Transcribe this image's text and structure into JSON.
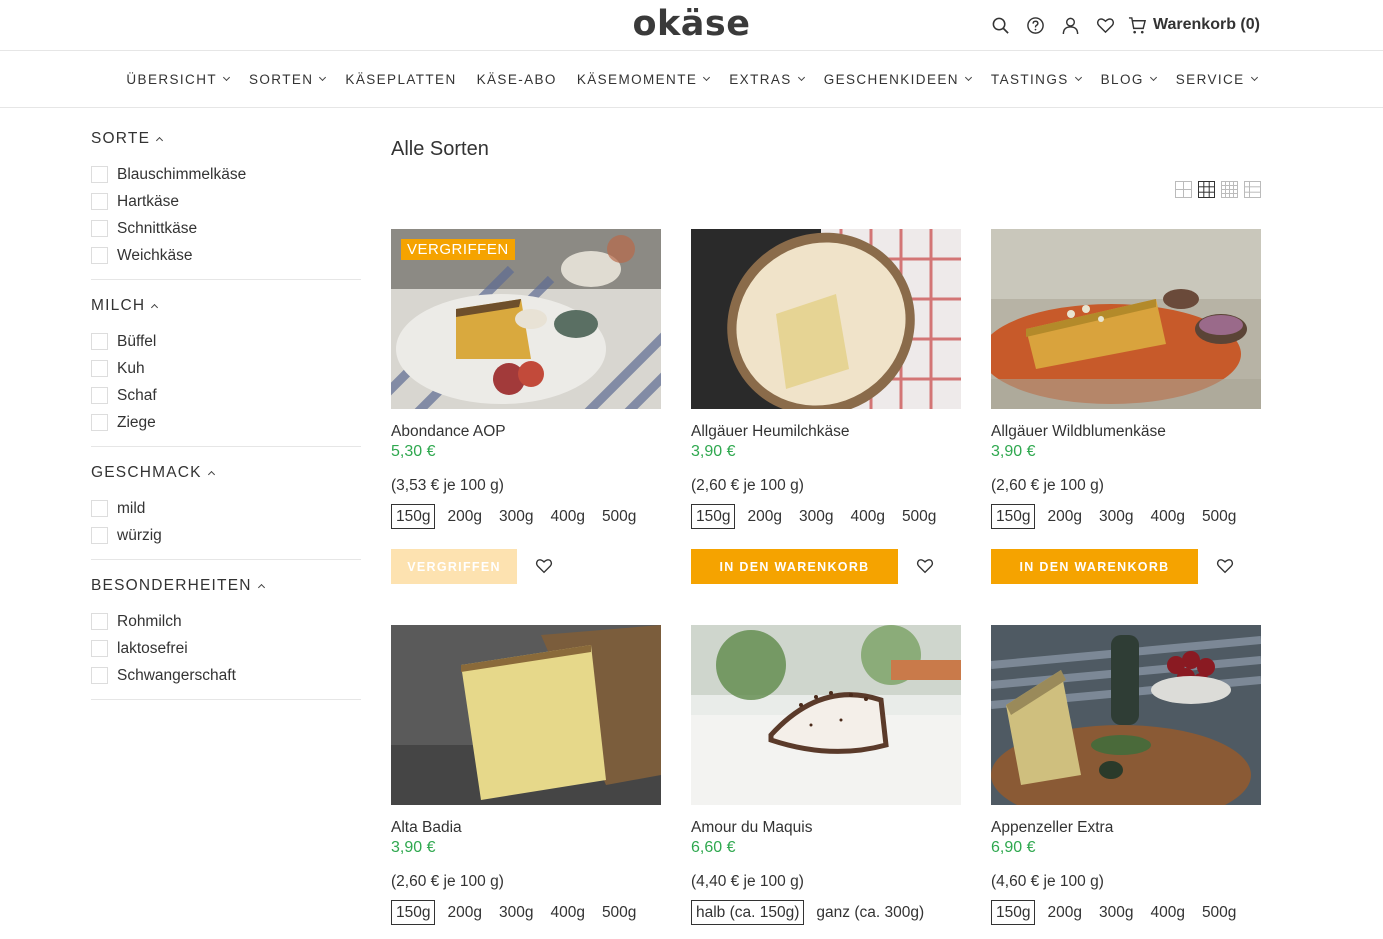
{
  "brand": {
    "logo": "okäse",
    "accent": "#f5a300",
    "price_color": "#2fa84f"
  },
  "header": {
    "icons": [
      "search-icon",
      "help-icon",
      "account-icon",
      "wishlist-icon"
    ],
    "cart_label": "Warenkorb (0)"
  },
  "nav": [
    "ÜBERSICHT",
    "SORTEN",
    "KÄSEPLATTEN",
    "KÄSE-ABO",
    "KÄSEMOMENTE",
    "EXTRAS",
    "GESCHENKIDEEN",
    "TASTINGS",
    "BLOG",
    "SERVICE"
  ],
  "filters": [
    {
      "title": "SORTE",
      "options": [
        "Blauschimmelkäse",
        "Hartkäse",
        "Schnittkäse",
        "Weichkäse"
      ]
    },
    {
      "title": "MILCH",
      "options": [
        "Büffel",
        "Kuh",
        "Schaf",
        "Ziege"
      ]
    },
    {
      "title": "GESCHMACK",
      "options": [
        "mild",
        "würzig"
      ]
    },
    {
      "title": "BESONDERHEITEN",
      "options": [
        "Rohmilch",
        "laktosefrei",
        "Schwangerschaft"
      ]
    }
  ],
  "main": {
    "title": "Alle Sorten",
    "view_toggles": [
      "grid-2-icon",
      "grid-3-icon",
      "grid-4-icon",
      "list-icon"
    ]
  },
  "products": [
    {
      "name": "Abondance AOP",
      "price": "5,30 €",
      "unit": "(3,53 € je 100 g)",
      "sizes": [
        "150g",
        "200g",
        "300g",
        "400g",
        "500g"
      ],
      "selected": 0,
      "badge": "VERGRIFFEN",
      "button": "VERGRIFFEN",
      "available": false
    },
    {
      "name": "Allgäuer Heumilchkäse",
      "price": "3,90 €",
      "unit": "(2,60 € je 100 g)",
      "sizes": [
        "150g",
        "200g",
        "300g",
        "400g",
        "500g"
      ],
      "selected": 0,
      "badge": "",
      "button": "IN DEN WARENKORB",
      "available": true
    },
    {
      "name": "Allgäuer Wildblumenkäse",
      "price": "3,90 €",
      "unit": "(2,60 € je 100 g)",
      "sizes": [
        "150g",
        "200g",
        "300g",
        "400g",
        "500g"
      ],
      "selected": 0,
      "badge": "",
      "button": "IN DEN WARENKORB",
      "available": true
    },
    {
      "name": "Alta Badia",
      "price": "3,90 €",
      "unit": "(2,60 € je 100 g)",
      "sizes": [
        "150g",
        "200g",
        "300g",
        "400g",
        "500g"
      ],
      "selected": 0,
      "badge": "",
      "button": "",
      "available": true
    },
    {
      "name": "Amour du Maquis",
      "price": "6,60 €",
      "unit": "(4,40 € je 100 g)",
      "sizes": [
        "halb (ca. 150g)",
        "ganz (ca. 300g)"
      ],
      "selected": 0,
      "badge": "",
      "button": "",
      "available": true
    },
    {
      "name": "Appenzeller Extra",
      "price": "6,90 €",
      "unit": "(4,60 € je 100 g)",
      "sizes": [
        "150g",
        "200g",
        "300g",
        "400g",
        "500g"
      ],
      "selected": 0,
      "badge": "",
      "button": "",
      "available": true
    }
  ]
}
